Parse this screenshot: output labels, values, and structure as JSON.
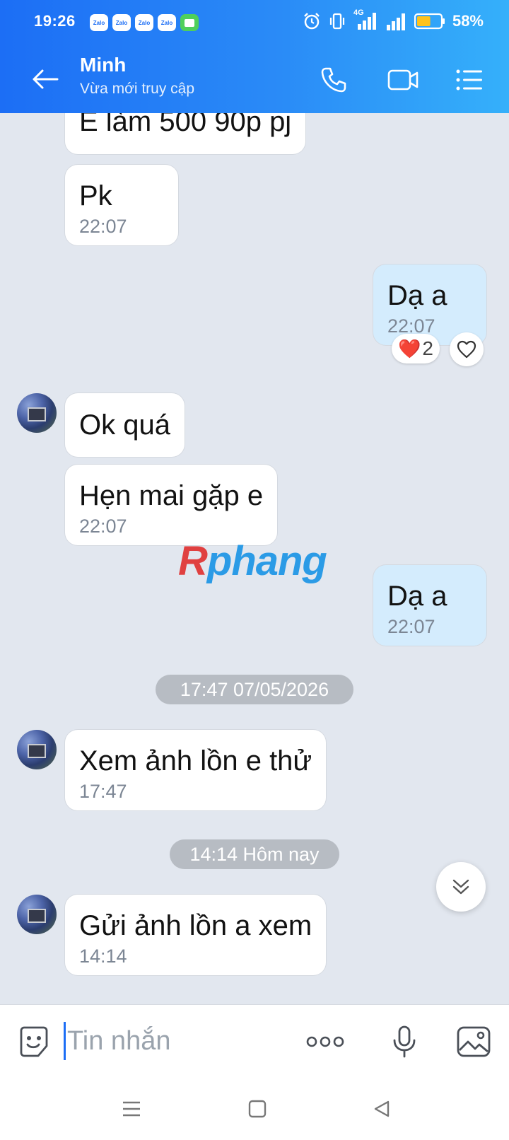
{
  "status_bar": {
    "time": "19:26",
    "notification_icons": [
      "Zalo",
      "Zalo",
      "Zalo",
      "Zalo"
    ],
    "network": "4G",
    "battery_percent": "58%",
    "battery_level": 0.58
  },
  "header": {
    "contact_name": "Minh",
    "contact_status": "Vừa mới truy cập",
    "icons": [
      "back-arrow-icon",
      "phone-icon",
      "video-call-icon",
      "options-list-icon"
    ],
    "accent_color": "#1c6ef5"
  },
  "messages": [
    {
      "text": "E làm 500 90p pj",
      "time": ""
    },
    {
      "text": "Pk",
      "time": "22:07"
    },
    {
      "text": "Dạ a",
      "time": "22:07"
    },
    {
      "text": "Ok quá",
      "time": ""
    },
    {
      "text": "Hẹn mai gặp e",
      "time": "22:07"
    },
    {
      "text": "Dạ a",
      "time": "22:07"
    },
    {
      "text": "Xem ảnh lồn e thử",
      "time": "17:47"
    },
    {
      "text": "Gửi ảnh lồn a xem",
      "time": "14:14"
    }
  ],
  "reaction": {
    "emoji": "❤️",
    "count": "2"
  },
  "date_separators": [
    "17:47 07/05/2026",
    "14:14 Hôm nay"
  ],
  "watermark": {
    "first": "R",
    "rest": "phang"
  },
  "input_bar": {
    "placeholder": "Tin nhắn",
    "value": ""
  }
}
